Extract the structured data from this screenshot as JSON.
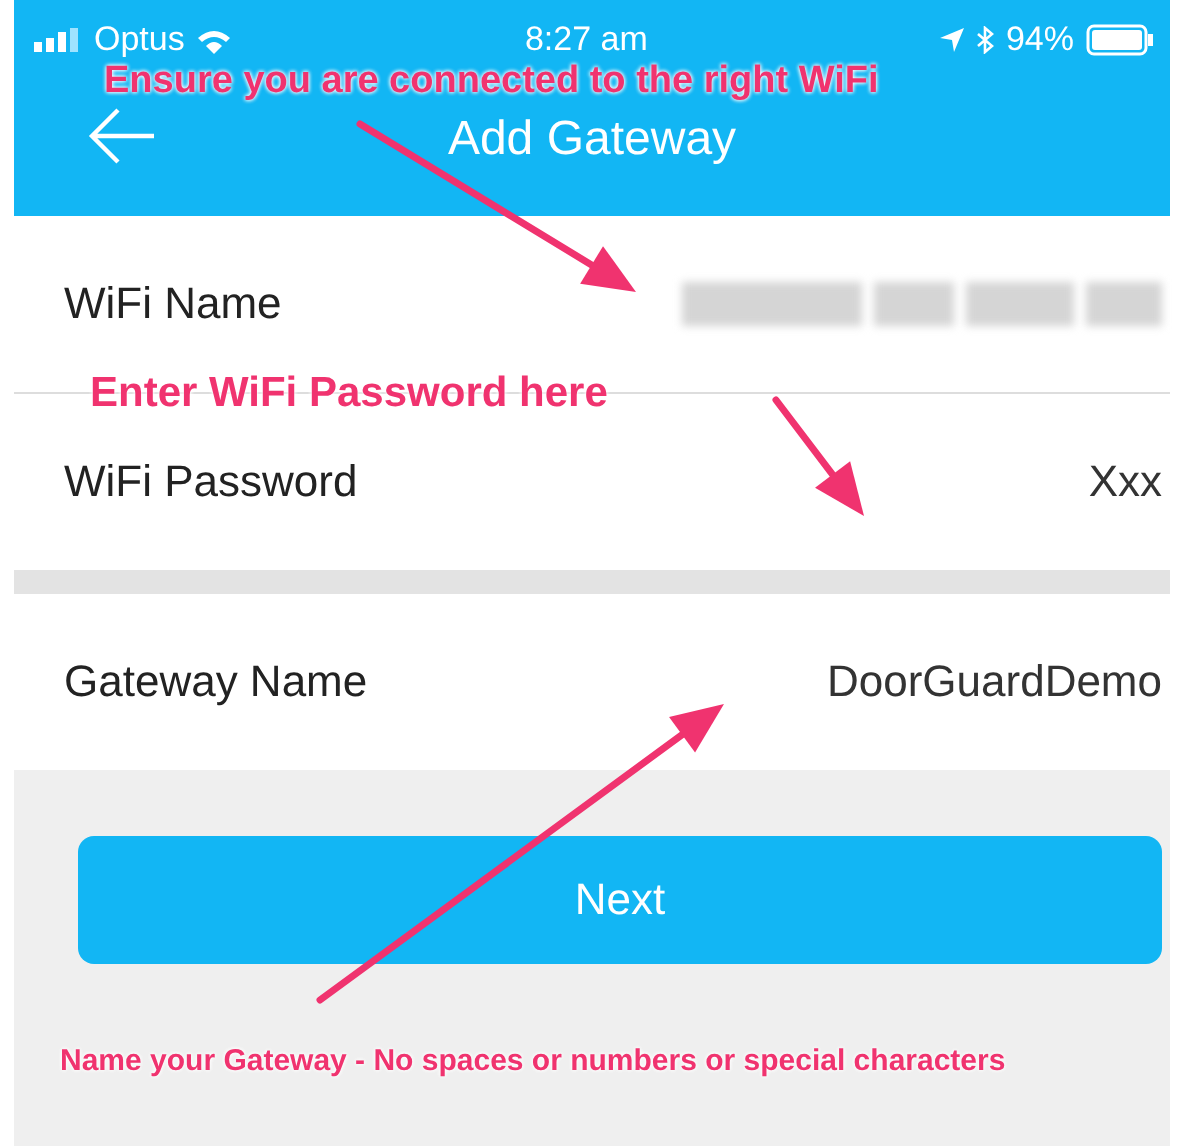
{
  "status_bar": {
    "carrier": "Optus",
    "time": "8:27 am",
    "battery": "94%"
  },
  "header": {
    "title": "Add Gateway"
  },
  "sections": [
    [
      {
        "label": "WiFi Name",
        "kind": "redacted"
      },
      {
        "label": "WiFi Password",
        "kind": "text",
        "value": "Xxx"
      }
    ],
    [
      {
        "label": "Gateway Name",
        "kind": "text",
        "value": "DoorGuardDemo"
      }
    ]
  ],
  "button": {
    "label": "Next"
  },
  "annotations": [
    "Ensure you are connected to the right WiFi",
    "Enter WiFi Password here",
    "Name your Gateway - No spaces or numbers or special characters"
  ]
}
